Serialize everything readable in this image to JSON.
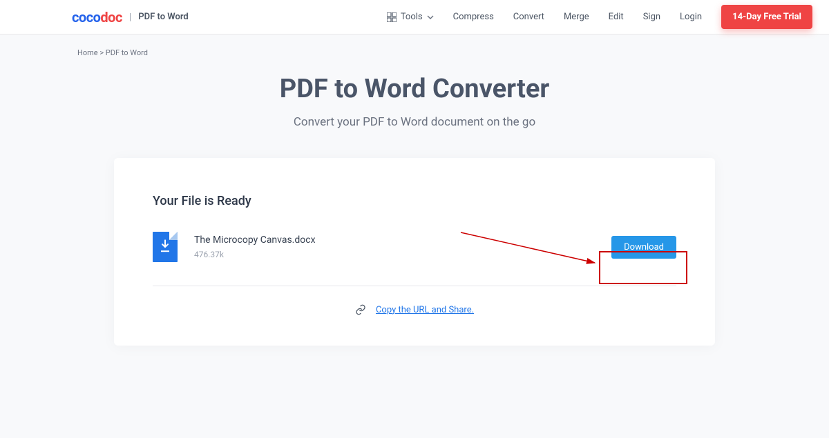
{
  "header": {
    "logo_coco": "coco",
    "logo_doc": "doc",
    "logo_label": "PDF to Word",
    "nav": {
      "tools": "Tools",
      "compress": "Compress",
      "convert": "Convert",
      "merge": "Merge",
      "edit": "Edit",
      "sign": "Sign",
      "login": "Login",
      "trial": "14-Day Free Trial"
    }
  },
  "breadcrumb": "Home > PDF to Word",
  "title": "PDF to Word Converter",
  "subtitle": "Convert your PDF to Word document on the go",
  "card": {
    "ready": "Your File is Ready",
    "file_name": "The Microcopy Canvas.docx",
    "file_size": "476.37k",
    "download": "Download",
    "share": "Copy the URL and Share."
  }
}
